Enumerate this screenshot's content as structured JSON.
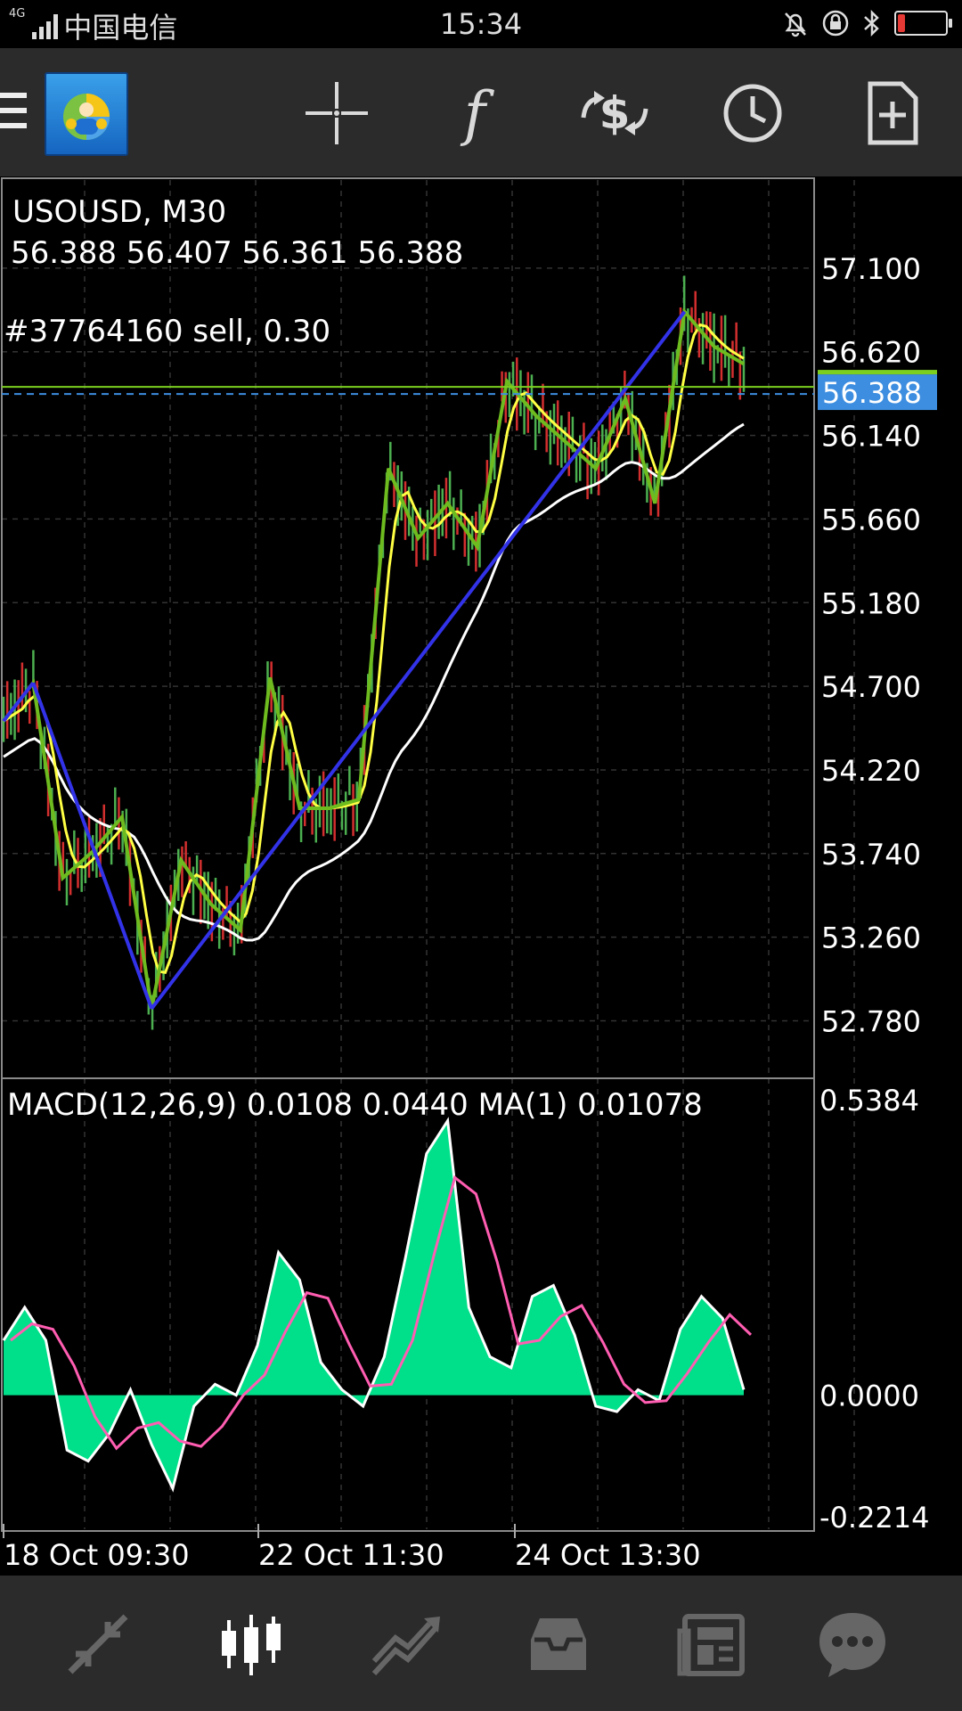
{
  "status_bar": {
    "network": "4G",
    "carrier": "中国电信",
    "time": "15:34"
  },
  "toolbar": {
    "icons": [
      "menu-icon",
      "app-logo",
      "crosshair-icon",
      "indicators-icon",
      "trade-icon",
      "timeframe-icon",
      "new-document-icon"
    ]
  },
  "chart": {
    "symbol_line": "USOUSD, M30",
    "ohlc_line": "56.388 56.407 56.361 56.388",
    "order_label": "#37764160 sell, 0.30",
    "current_price": "56.388",
    "price_ticks": [
      "57.100",
      "56.620",
      "56.140",
      "55.660",
      "55.180",
      "54.700",
      "54.220",
      "53.740",
      "53.260",
      "52.780"
    ],
    "macd_label": "MACD(12,26,9) 0.0108 0.0440 MA(1) 0.01078",
    "macd_ticks": [
      "0.5384",
      "0.0000",
      "-0.2214"
    ],
    "time_labels": [
      "18 Oct 09:30",
      "22 Oct 11:30",
      "24 Oct 13:30"
    ],
    "colors": {
      "candle_up": "#4caf50",
      "candle_down": "#d32f2f",
      "ma_fast": "#ffff44",
      "ma_slow": "#ffffff",
      "zigzag": "#6dbb1f",
      "trendline": "#3232e8",
      "order_line": "#7ccf1f",
      "price_badge": "#3d8ee0",
      "macd_hist": "#00e08a",
      "macd_signal": "#ff5db1"
    }
  },
  "chart_data": {
    "type": "line",
    "symbol": "USOUSD",
    "timeframe": "M30",
    "x": [
      "18 Oct 09:30",
      "22 Oct 11:30",
      "24 Oct 13:30"
    ],
    "ylim": [
      52.45,
      57.35
    ],
    "series": [
      {
        "values": [
          54.5,
          54.72,
          53.6,
          53.75,
          53.95,
          52.85,
          53.7,
          53.45,
          53.3,
          54.75,
          54.0,
          54.0,
          54.05,
          55.95,
          55.55,
          55.75,
          55.5,
          56.45,
          56.25,
          56.1,
          55.95,
          56.35,
          55.75,
          56.85,
          56.65,
          56.55
        ]
      }
    ],
    "macd_ylim": [
      -0.2214,
      0.5384
    ],
    "macd_values": [
      0.1,
      0.16,
      0.1,
      -0.1,
      -0.12,
      -0.07,
      0.01,
      -0.09,
      -0.17,
      -0.02,
      0.02,
      0.0,
      0.09,
      0.26,
      0.21,
      0.06,
      0.01,
      -0.02,
      0.07,
      0.25,
      0.44,
      0.5,
      0.16,
      0.07,
      0.05,
      0.18,
      0.2,
      0.11,
      -0.02,
      -0.03,
      0.01,
      -0.01,
      0.12,
      0.18,
      0.14,
      0.01
    ]
  },
  "bottom_nav": {
    "icons": [
      "quotes-icon",
      "chart-icon",
      "trade-icon",
      "history-icon",
      "news-icon",
      "chat-icon"
    ]
  }
}
